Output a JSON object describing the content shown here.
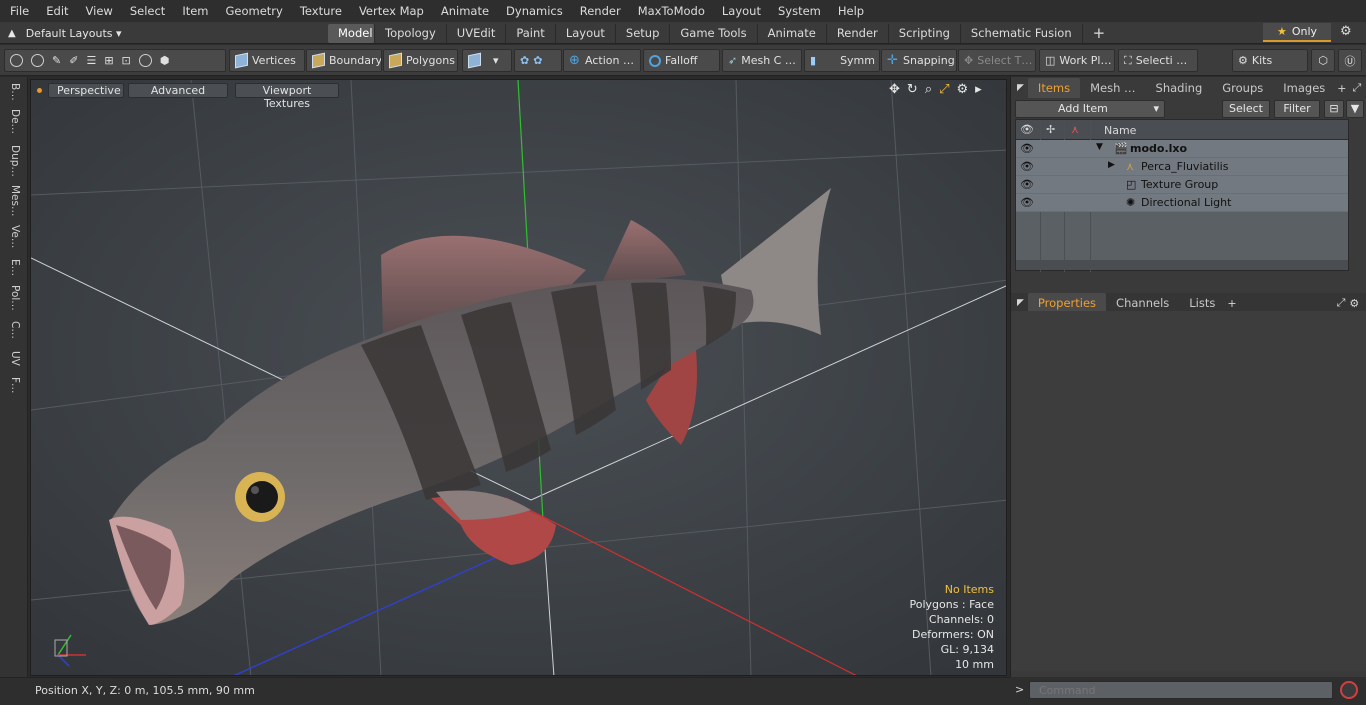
{
  "menubar": {
    "items": [
      "File",
      "Edit",
      "View",
      "Select",
      "Item",
      "Geometry",
      "Texture",
      "Vertex Map",
      "Animate",
      "Dynamics",
      "Render",
      "MaxToModo",
      "Layout",
      "System",
      "Help"
    ]
  },
  "layouts": {
    "label": "Default Layouts ▾"
  },
  "tabs": [
    "Model",
    "Topology",
    "UVEdit",
    "Paint",
    "Layout",
    "Setup",
    "Game Tools",
    "Animate",
    "Render",
    "Scripting",
    "Schematic Fusion"
  ],
  "active_tab": "Model",
  "only_label": "Only",
  "toolbar": {
    "vertices": "Vertices",
    "boundary": "Boundary",
    "polygons": "Polygons",
    "action": "Action …",
    "falloff": "Falloff",
    "mesh": "Mesh C …",
    "symm": "Symm …",
    "snapping": "Snapping",
    "select_t": "Select T…",
    "workpl": "Work Pl…",
    "selecti": "Selecti …",
    "kits": "Kits"
  },
  "left_tabs": [
    "B…",
    "De…",
    "Dup…",
    "Mes…",
    "Ve…",
    "E…",
    "Pol…",
    "C…",
    "UV",
    "F…"
  ],
  "viewport": {
    "perspective": "Perspective",
    "advanced": "Advanced",
    "textures": "Viewport Textures"
  },
  "stats": {
    "no_items": "No Items",
    "polygons": "Polygons : Face",
    "channels": "Channels: 0",
    "deformers": "Deformers: ON",
    "gl": "GL: 9,134",
    "unit": "10 mm"
  },
  "status": {
    "position": "Position X, Y, Z:   0 m, 105.5 mm, 90 mm"
  },
  "items_panel": {
    "tabs": [
      "Items",
      "Mesh …",
      "Shading",
      "Groups",
      "Images"
    ],
    "add_item": "Add Item",
    "select": "Select",
    "filter": "Filter",
    "name_header": "Name",
    "rows": [
      {
        "label": "modo.lxo",
        "bold": true
      },
      {
        "label": "Perca_Fluviatilis"
      },
      {
        "label": "Texture Group"
      },
      {
        "label": "Directional Light"
      }
    ]
  },
  "props_panel": {
    "tabs": [
      "Properties",
      "Channels",
      "Lists"
    ]
  },
  "command": {
    "placeholder": "Command"
  },
  "colors": {
    "accent": "#f0a030",
    "viewport_bg": "#3c4146",
    "axis_x": "#d03030",
    "axis_y": "#30c030",
    "axis_z": "#3040d0"
  }
}
